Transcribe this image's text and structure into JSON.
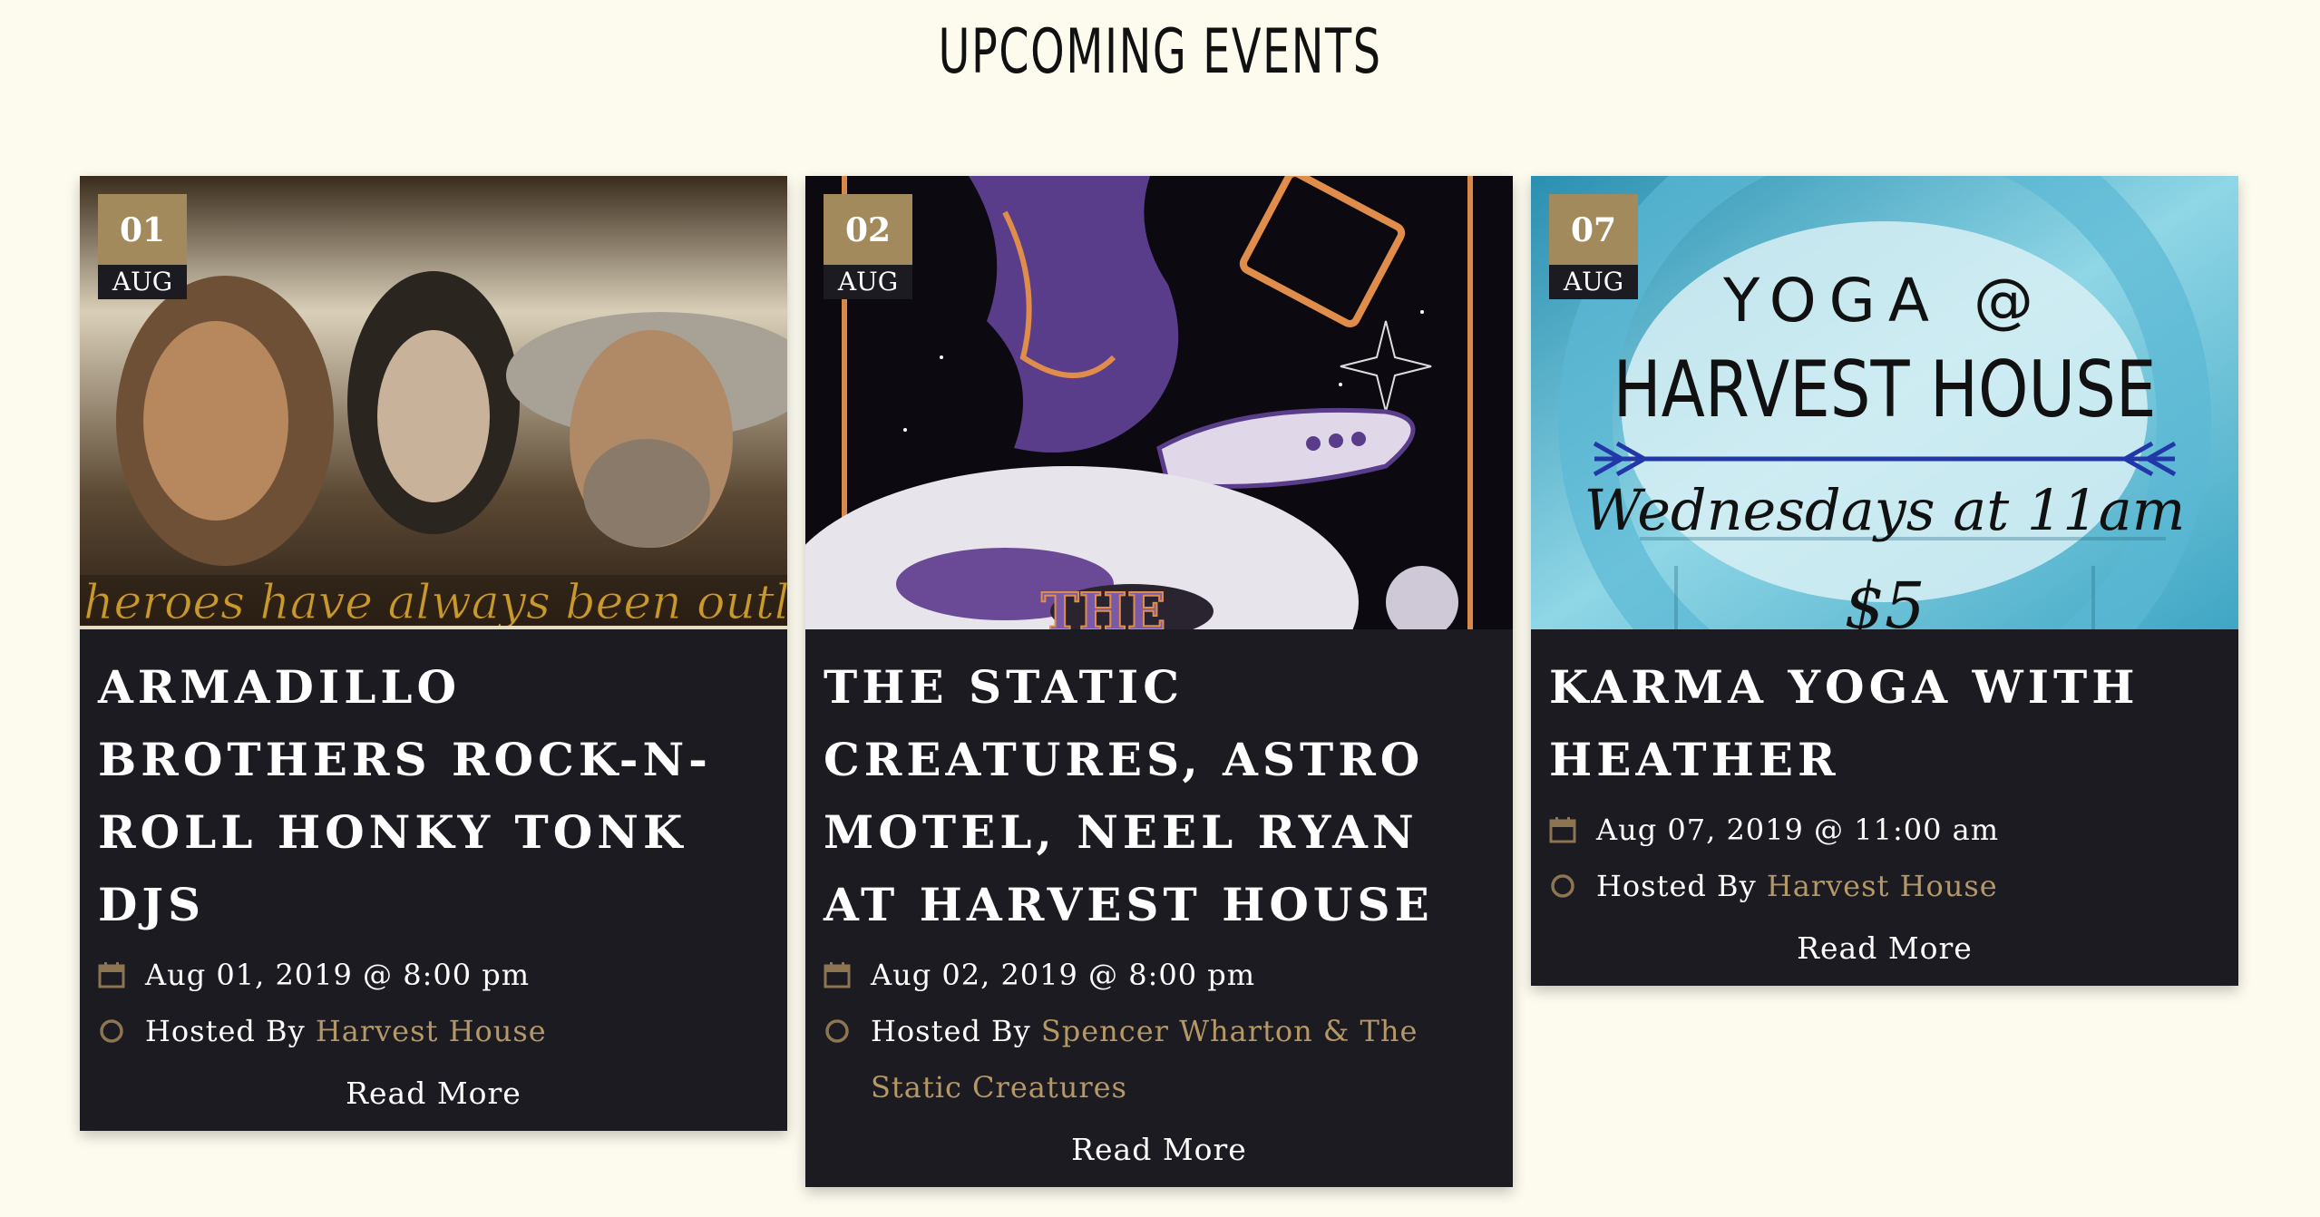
{
  "section": {
    "title": "UPCOMING EVENTS"
  },
  "colors": {
    "background": "#fdfbee",
    "card": "#1c1b22",
    "accent": "#a38a5c",
    "link": "#b69867"
  },
  "events": [
    {
      "day": "01",
      "month": "AUG",
      "title": "ARMADILLO BROTHERS ROCK-N-ROLL HONKY TONK DJS",
      "datetime": "Aug 01, 2019 @ 8:00 pm",
      "hosted_by_label": "Hosted By",
      "host": "Harvest House",
      "read_more": "Read More",
      "image_caption": "heroes have always been outl"
    },
    {
      "day": "02",
      "month": "AUG",
      "title": "THE STATIC CREATURES, ASTRO MOTEL, NEEL RYAN AT HARVEST HOUSE",
      "datetime": "Aug 02, 2019 @ 8:00 pm",
      "hosted_by_label": "Hosted By",
      "host": "Spencer Wharton & The Static Creatures",
      "read_more": "Read More",
      "image_caption": "THE"
    },
    {
      "day": "07",
      "month": "AUG",
      "title": "KARMA YOGA WITH HEATHER",
      "datetime": "Aug 07, 2019 @ 11:00 am",
      "hosted_by_label": "Hosted By",
      "host": "Harvest House",
      "read_more": "Read More",
      "image_line1": "YOGA @",
      "image_line2": "HARVEST HOUSE",
      "image_line3": "Wednesdays at 11am",
      "image_line4": "$5"
    }
  ]
}
